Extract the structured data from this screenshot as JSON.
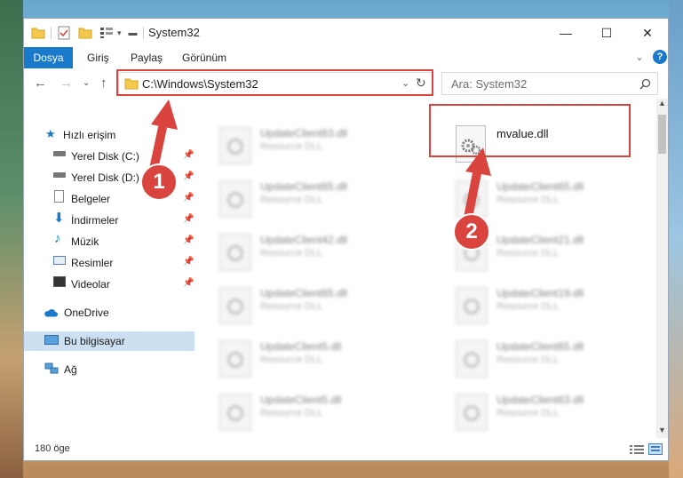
{
  "window": {
    "title": "System32",
    "controls": {
      "minimize": "—",
      "maximize": "☐",
      "close": "✕"
    }
  },
  "ribbon": {
    "tabs": [
      "Dosya",
      "Giriş",
      "Paylaş",
      "Görünüm"
    ],
    "expand_icon": "chevron-down-icon",
    "help_label": "?"
  },
  "address": {
    "path": "C:\\Windows\\System32",
    "search_placeholder": "Ara: System32"
  },
  "nav": {
    "quick_access": "Hızlı erişim",
    "pinned": [
      "Yerel Disk (C:)",
      "Yerel Disk (D:)",
      "Belgeler",
      "İndirmeler",
      "Müzik",
      "Resimler",
      "Videolar"
    ],
    "onedrive": "OneDrive",
    "this_pc": "Bu bilgisayar",
    "network": "Ağ"
  },
  "files": {
    "left_column": [
      {
        "name": "UpdateClient63.dll",
        "type": "Resource DLL"
      },
      {
        "name": "UpdateClient65.dll",
        "type": "Resource DLL"
      },
      {
        "name": "UpdateClient42.dll",
        "type": "Resource DLL"
      },
      {
        "name": "UpdateClient65.dll",
        "type": "Resource DLL"
      },
      {
        "name": "UpdateClient5.dll",
        "type": "Resource DLL"
      },
      {
        "name": "UpdateClient5.dll",
        "type": "Resource DLL"
      }
    ],
    "right_column": [
      {
        "name": "UpdateClient65.dll",
        "type": "Resource DLL"
      },
      {
        "name": "UpdateClient21.dll",
        "type": "Resource DLL"
      },
      {
        "name": "UpdateClient19.dll",
        "type": "Resource DLL"
      },
      {
        "name": "UpdateClient65.dll",
        "type": "Resource DLL"
      },
      {
        "name": "UpdateClient63.dll",
        "type": "Resource DLL"
      }
    ],
    "highlighted": {
      "name": "mvalue.dll"
    }
  },
  "status": {
    "item_count": "180 öge"
  },
  "callouts": {
    "step1": "1",
    "step2": "2"
  },
  "colors": {
    "accent": "#1979ca",
    "callout_red": "#d9443f",
    "selection": "#cce0f2"
  }
}
